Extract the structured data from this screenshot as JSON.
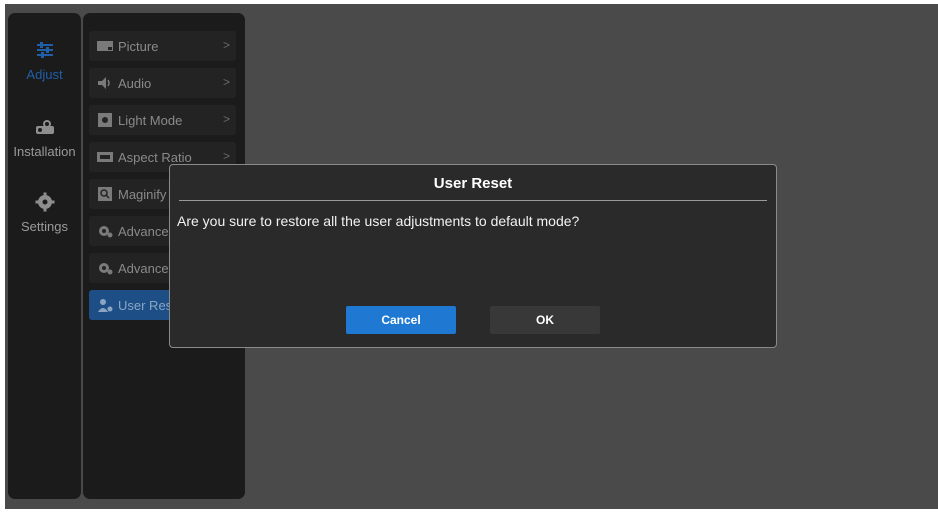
{
  "rail": {
    "items": [
      {
        "label": "Adjust",
        "icon": "sliders-icon"
      },
      {
        "label": "Installation",
        "icon": "projector-icon"
      },
      {
        "label": "Settings",
        "icon": "gear-icon"
      }
    ]
  },
  "submenu": {
    "items": [
      {
        "label": "Picture",
        "icon": "picture-icon",
        "chevron": ">"
      },
      {
        "label": "Audio",
        "icon": "speaker-icon",
        "chevron": ">"
      },
      {
        "label": "Light Mode",
        "icon": "light-mode-icon",
        "chevron": ">"
      },
      {
        "label": "Aspect Ratio",
        "icon": "aspect-ratio-icon",
        "chevron": ">"
      },
      {
        "label": "Maginify",
        "icon": "magnify-icon"
      },
      {
        "label": "Advance",
        "icon": "advanced-gear-icon"
      },
      {
        "label": "Advance",
        "icon": "advanced-gear-icon"
      },
      {
        "label": "User Res",
        "icon": "user-reset-icon"
      }
    ]
  },
  "dialog": {
    "title": "User Reset",
    "message": "Are you sure to restore all the user adjustments to default mode?",
    "cancel_label": "Cancel",
    "ok_label": "OK"
  },
  "colors": {
    "accent": "#1f78d1",
    "active_rail": "#1f5fa8",
    "selected_item": "#1d4f86"
  }
}
